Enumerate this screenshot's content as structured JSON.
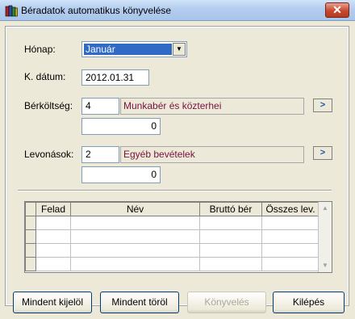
{
  "window": {
    "title": "Béradatok automatikus könyvelése",
    "close_symbol": "✕",
    "app_icon": "books-icon"
  },
  "form": {
    "month_label": "Hónap:",
    "month_value": "Január",
    "date_label": "K. dátum:",
    "date_value": "2012.01.31",
    "salary_label": "Bérköltség:",
    "salary_code": "4",
    "salary_name": "Munkabér és közterhei",
    "salary_amount": "0",
    "deductions_label": "Levonások:",
    "deductions_code": "2",
    "deductions_name": "Egyéb bevételek",
    "deductions_amount": "0",
    "lookup_symbol": ">"
  },
  "table": {
    "columns": [
      "Felad",
      "Név",
      "Bruttó bér",
      "Összes lev."
    ],
    "rows": [
      [
        "",
        "",
        "",
        ""
      ],
      [
        "",
        "",
        "",
        ""
      ],
      [
        "",
        "",
        "",
        ""
      ],
      [
        "",
        "",
        "",
        ""
      ]
    ]
  },
  "buttons": {
    "select_all": "Mindent kijelöl",
    "clear_all": "Mindent töröl",
    "post": "Könyvelés",
    "exit": "Kilépés"
  },
  "scroll": {
    "up": "▲",
    "down": "▼"
  },
  "colors": {
    "title_bar": "#b3cdee",
    "highlight": "#316ac5",
    "readonly_text": "#7a1040"
  }
}
